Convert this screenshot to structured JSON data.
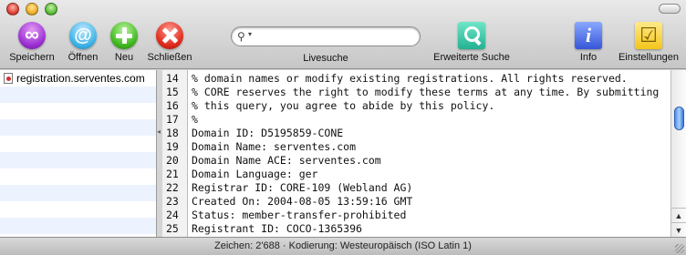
{
  "toolbar": {
    "save_label": "Speichern",
    "open_label": "Öffnen",
    "new_label": "Neu",
    "close_label": "Schließen",
    "search_label": "Livesuche",
    "search_value": "",
    "advanced_search_label": "Erweiterte Suche",
    "info_label": "Info",
    "settings_label": "Einstellungen"
  },
  "sidebar": {
    "items": [
      {
        "label": "registration.serventes.com"
      }
    ]
  },
  "content": {
    "lines": [
      {
        "n": "14",
        "text": "% domain names or modify existing registrations. All rights reserved."
      },
      {
        "n": "15",
        "text": "% CORE reserves the right to modify these terms at any time. By submitting"
      },
      {
        "n": "16",
        "text": "% this query, you agree to abide by this policy."
      },
      {
        "n": "17",
        "text": "%"
      },
      {
        "n": "18",
        "text": "Domain ID: D5195859-CONE"
      },
      {
        "n": "19",
        "text": "Domain Name: serventes.com"
      },
      {
        "n": "20",
        "text": "Domain Name ACE: serventes.com"
      },
      {
        "n": "21",
        "text": "Domain Language: ger"
      },
      {
        "n": "22",
        "text": "Registrar ID: CORE-109 (Webland AG)"
      },
      {
        "n": "23",
        "text": "Created On: 2004-08-05 13:59:16 GMT"
      },
      {
        "n": "24",
        "text": "Status: member-transfer-prohibited"
      },
      {
        "n": "25",
        "text": "Registrant ID: COCO-1365396"
      }
    ]
  },
  "status": {
    "text": "Zeichen: 2'688  ·  Kodierung: Westeuropäisch (ISO Latin 1)"
  }
}
